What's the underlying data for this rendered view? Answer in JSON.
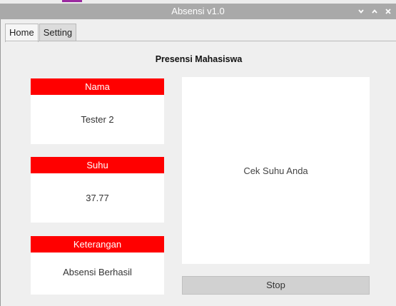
{
  "window": {
    "title": "Absensi v1.0",
    "controls": {
      "minimize": "⌄",
      "maximize": "⌃",
      "close": "×"
    }
  },
  "tabs": [
    {
      "label": "Home",
      "active": true
    },
    {
      "label": "Setting",
      "active": false
    }
  ],
  "main": {
    "heading": "Presensi Mahasiswa",
    "fields": {
      "nama": {
        "label": "Nama",
        "value": "Tester 2"
      },
      "suhu": {
        "label": "Suhu",
        "value": "37.77"
      },
      "keterangan": {
        "label": "Keterangan",
        "value": "Absensi Berhasil"
      }
    },
    "display_text": "Cek Suhu Anda",
    "stop_label": "Stop"
  },
  "colors": {
    "label_bar": "#ff0000",
    "titlebar": "#a9a9a9",
    "button": "#d1d1d1"
  }
}
